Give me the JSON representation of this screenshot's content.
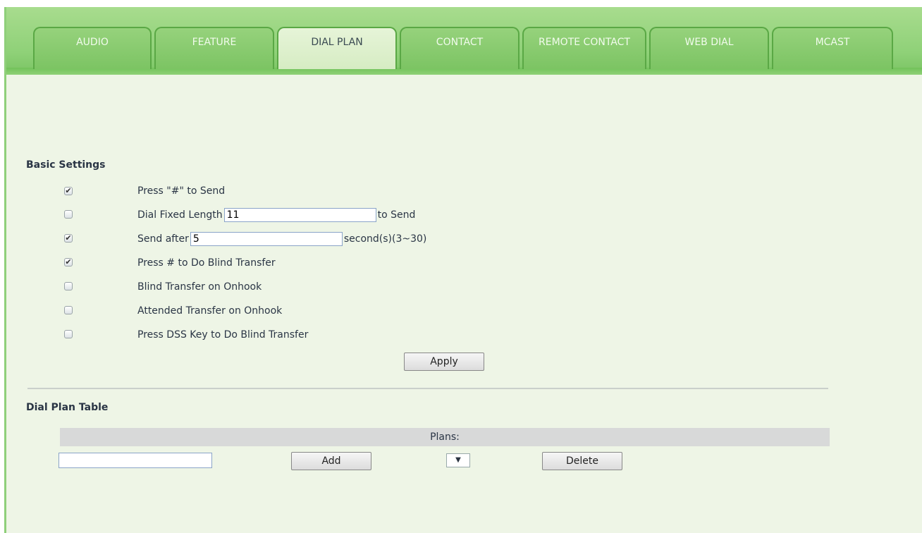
{
  "tabs": [
    {
      "label": "AUDIO",
      "active": false
    },
    {
      "label": "FEATURE",
      "active": false
    },
    {
      "label": "DIAL PLAN",
      "active": true
    },
    {
      "label": "CONTACT",
      "active": false
    },
    {
      "label": "REMOTE CONTACT",
      "active": false
    },
    {
      "label": "WEB DIAL",
      "active": false
    },
    {
      "label": "MCAST",
      "active": false
    }
  ],
  "basic": {
    "title": "Basic Settings",
    "items": [
      {
        "label": "Press \"#\" to Send",
        "checked": true
      },
      {
        "label": "Dial Fixed Length",
        "checked": false,
        "value": "11",
        "suffix": "to Send"
      },
      {
        "label": "Send after",
        "checked": true,
        "value": "5",
        "suffix": "second(s)(3~30)"
      },
      {
        "label": "Press # to Do Blind Transfer",
        "checked": true
      },
      {
        "label": "Blind Transfer on Onhook",
        "checked": false
      },
      {
        "label": "Attended Transfer on Onhook",
        "checked": false
      },
      {
        "label": "Press DSS Key to Do Blind Transfer",
        "checked": false
      }
    ],
    "apply_label": "Apply"
  },
  "dialplan": {
    "title": "Dial Plan Table",
    "plans_header": "Plans:",
    "input_value": "",
    "add_label": "Add",
    "select_symbol": "▼",
    "delete_label": "Delete"
  },
  "colors": {
    "accent": "#8fd178",
    "panel": "#eef5e6",
    "active_tab": "#dff0cf"
  }
}
